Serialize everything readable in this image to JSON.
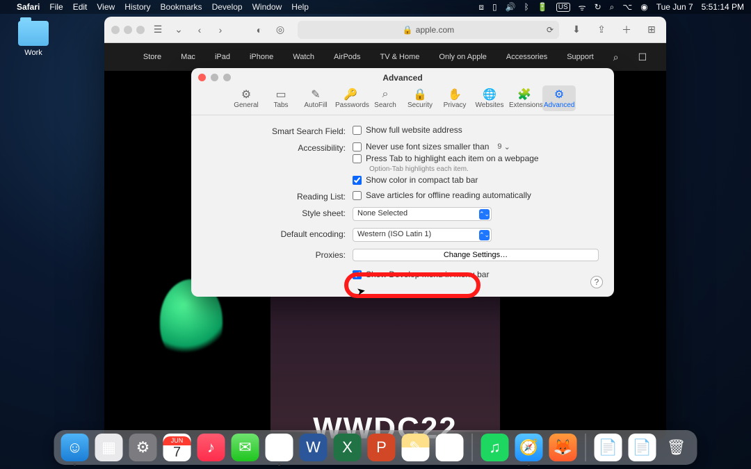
{
  "menubar": {
    "app": "Safari",
    "items": [
      "File",
      "Edit",
      "View",
      "History",
      "Bookmarks",
      "Develop",
      "Window",
      "Help"
    ],
    "right": {
      "locale": "US",
      "date": "Tue Jun 7",
      "time": "5:51:14 PM"
    }
  },
  "desktop": {
    "work_folder": "Work"
  },
  "safari": {
    "url": "apple.com",
    "nav": [
      "Store",
      "Mac",
      "iPad",
      "iPhone",
      "Watch",
      "AirPods",
      "TV & Home",
      "Only on Apple",
      "Accessories",
      "Support"
    ],
    "bg_text": "WWDC22"
  },
  "dock_cal": {
    "month": "JUN",
    "day": "7"
  },
  "prefs": {
    "title": "Advanced",
    "tabs": [
      "General",
      "Tabs",
      "AutoFill",
      "Passwords",
      "Search",
      "Security",
      "Privacy",
      "Websites",
      "Extensions",
      "Advanced"
    ],
    "smart_label": "Smart Search Field:",
    "show_full": "Show full website address",
    "acc_label": "Accessibility:",
    "never_font": "Never use font sizes smaller than",
    "font_size": "9",
    "press_tab": "Press Tab to highlight each item on a webpage",
    "option_tab": "Option-Tab highlights each item.",
    "show_color": "Show color in compact tab bar",
    "reading_label": "Reading List:",
    "save_offline": "Save articles for offline reading automatically",
    "style_label": "Style sheet:",
    "style_val": "None Selected",
    "enc_label": "Default encoding:",
    "enc_val": "Western (ISO Latin 1)",
    "prox_label": "Proxies:",
    "prox_btn": "Change Settings…",
    "dev_menu": "Show Develop menu in menu bar",
    "help": "?"
  }
}
